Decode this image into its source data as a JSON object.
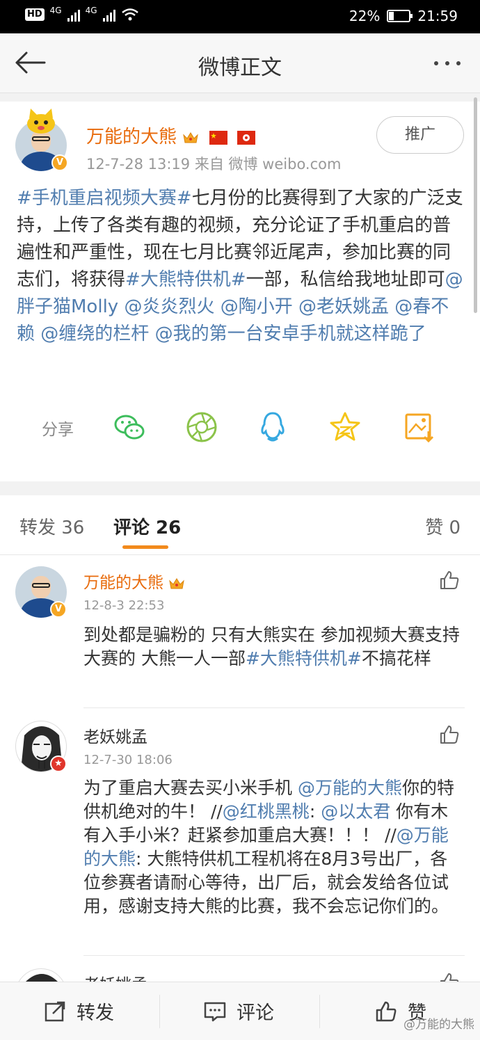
{
  "status_bar": {
    "hd_label": "HD",
    "net1": "4G",
    "net2": "4G",
    "battery_percent_text": "22%",
    "battery_level": 0.22,
    "time": "21:59"
  },
  "header": {
    "title": "微博正文"
  },
  "post": {
    "author": "万能的大熊",
    "meta": "12-7-28 13:19  来自 微博 weibo.com",
    "promote_label": "推广",
    "text_segments": [
      {
        "t": "#手机重启视频大赛#",
        "link": true
      },
      {
        "t": "七月份的比赛得到了大家的广泛支持，上传了各类有趣的视频，充分论证了手机重启的普遍性和严重性，现在七月比赛邻近尾声，参加比赛的同志们，将获得",
        "link": false
      },
      {
        "t": "#大熊特供机#",
        "link": true
      },
      {
        "t": "一部，私信给我地址即可",
        "link": false
      },
      {
        "t": "@胖子猫Molly",
        "link": true
      },
      {
        "t": " ",
        "link": false
      },
      {
        "t": "@炎炎烈火",
        "link": true
      },
      {
        "t": " ",
        "link": false
      },
      {
        "t": "@陶小开",
        "link": true
      },
      {
        "t": " ",
        "link": false
      },
      {
        "t": "@老妖姚孟",
        "link": true
      },
      {
        "t": " ",
        "link": false
      },
      {
        "t": "@春不赖",
        "link": true
      },
      {
        "t": " ",
        "link": false
      },
      {
        "t": "@缠绕的栏杆",
        "link": true
      },
      {
        "t": " ",
        "link": false
      },
      {
        "t": "@我的第一台安卓手机就这样跪了",
        "link": true
      }
    ],
    "share_label": "分享",
    "share_icons": [
      "wechat-icon",
      "moments-icon",
      "qq-icon",
      "qzone-icon",
      "save-image-icon"
    ]
  },
  "tabs": {
    "repost": "转发 36",
    "comment": "评论 26",
    "like": "赞 0"
  },
  "comments": [
    {
      "name": "万能的大熊",
      "time": "12-8-3 22:53",
      "segments": [
        {
          "t": "到处都是骗粉的 只有大熊实在 参加视频大赛支持大赛的 大熊一人一部",
          "link": false
        },
        {
          "t": "#大熊特供机#",
          "link": true
        },
        {
          "t": "不搞花样",
          "link": false
        }
      ]
    },
    {
      "name": "老妖姚孟",
      "time": "12-7-30 18:06",
      "segments": [
        {
          "t": "为了重启大赛去买小米手机 ",
          "link": false
        },
        {
          "t": "@万能的大熊",
          "link": true
        },
        {
          "t": "你的特供机绝对的牛！ //",
          "link": false
        },
        {
          "t": "@红桃黑桃",
          "link": true
        },
        {
          "t": ": ",
          "link": false
        },
        {
          "t": "@以太君",
          "link": true
        },
        {
          "t": " 你有木有入手小米？赶紧参加重启大赛！！！ //",
          "link": false
        },
        {
          "t": "@万能的大熊",
          "link": true
        },
        {
          "t": ": 大熊特供机工程机将在8月3号出厂，各位参赛者请耐心等待，出厂后，就会发给各位试用，感谢支持大熊的比赛，我不会忘记你们的。",
          "link": false
        }
      ]
    },
    {
      "name": "老妖姚孟"
    }
  ],
  "bottom_bar": {
    "repost": "转发",
    "comment": "评论",
    "like": "赞"
  },
  "watermark": "@万能的大熊",
  "colors": {
    "link": "#507daf",
    "author": "#e86b0c",
    "tab_underline": "#f28a1c"
  }
}
